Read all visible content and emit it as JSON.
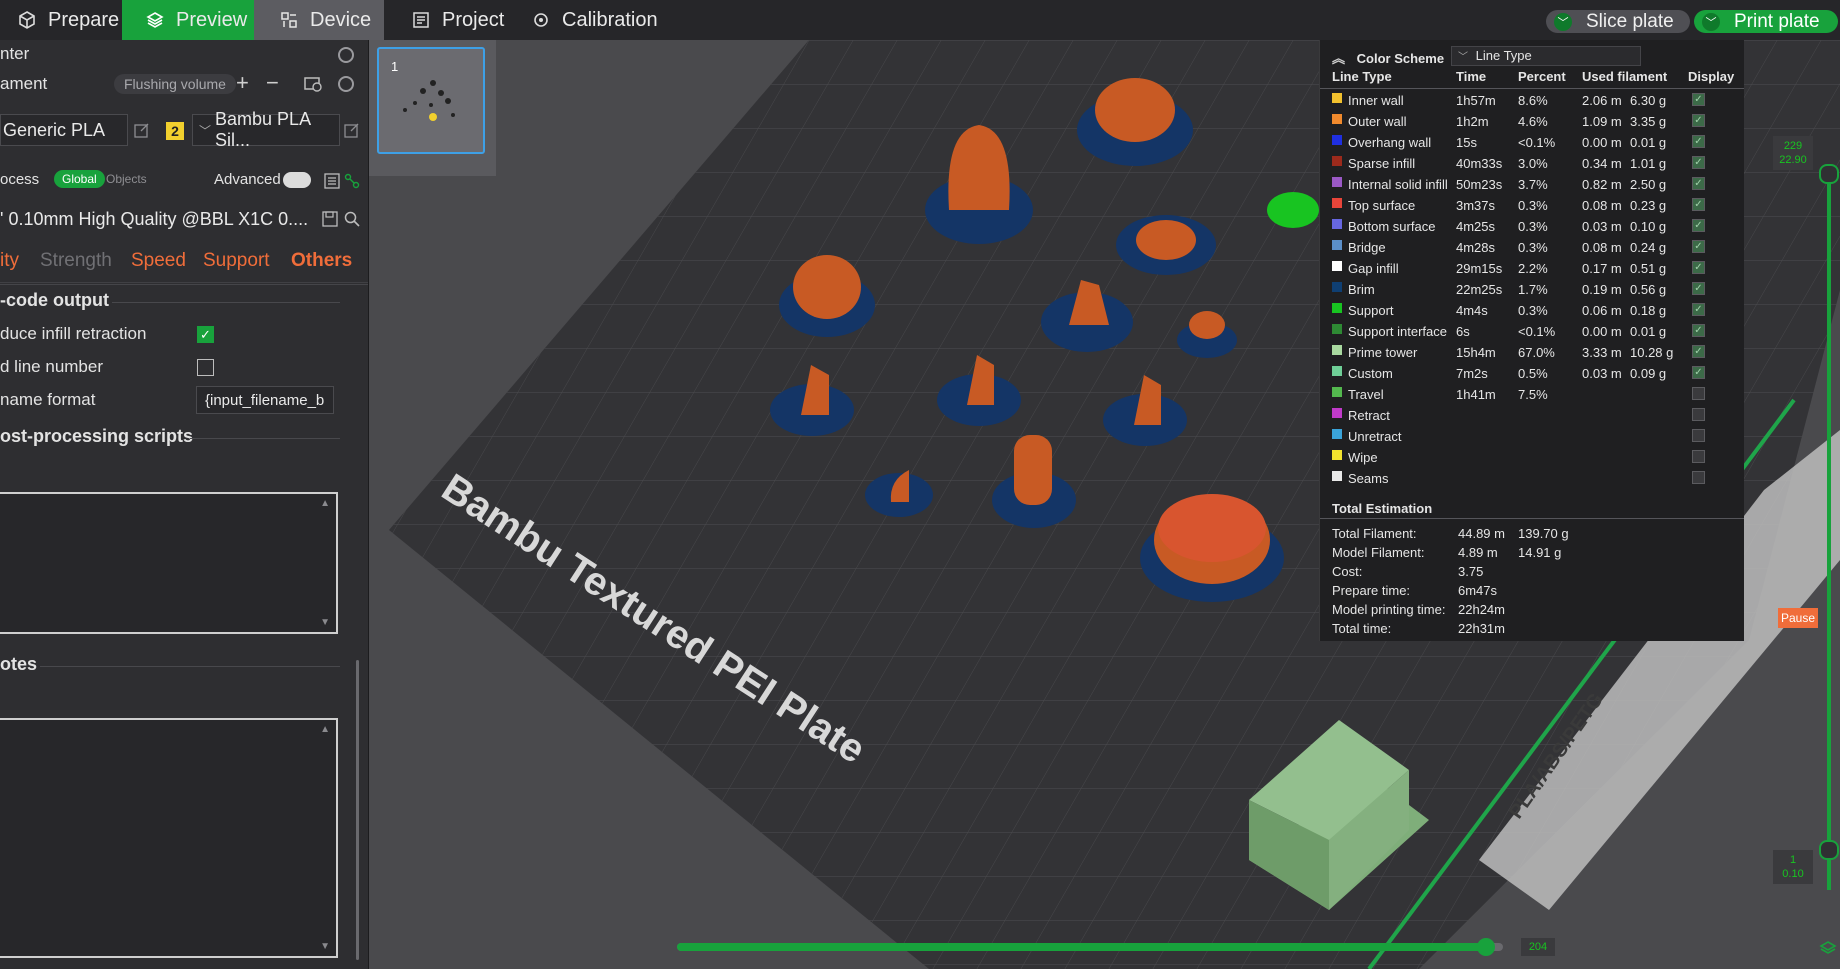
{
  "topbar": {
    "tabs": [
      {
        "label": "Prepare"
      },
      {
        "label": "Preview"
      },
      {
        "label": "Device"
      },
      {
        "label": "Project"
      },
      {
        "label": "Calibration"
      }
    ],
    "slice_label": "Slice plate",
    "print_label": "Print plate"
  },
  "sidebar": {
    "printer_label": "nter",
    "filament_label": "ament",
    "flushing_label": "Flushing volume",
    "plus": "+",
    "minus": "−",
    "filament1": "Generic PLA",
    "filament2_index": "2",
    "filament2": "Bambu PLA Sil...",
    "process_label": "ocess",
    "global_label": "Global",
    "objects_label": "Objects",
    "advanced_label": "Advanced",
    "profile": "' 0.10mm High Quality @BBL X1C 0....",
    "tabs": [
      "ity",
      "Strength",
      "Speed",
      "Support",
      "Others"
    ],
    "section_gcode": "-code output",
    "opt_reduce": "duce infill retraction",
    "opt_line": "d line number",
    "opt_filename": "name format",
    "filename_value": "{input_filename_b",
    "section_post": "ost-processing scripts",
    "section_notes": "otes"
  },
  "plate": {
    "thumb_number": "1",
    "bed_label": "Bambu Textured PEI Plate",
    "material_label": "PLA/ABS/PETG"
  },
  "legend": {
    "header": "Color Scheme",
    "scheme_value": "Line Type",
    "columns": [
      "Line Type",
      "Time",
      "Percent",
      "Used filament",
      "Display"
    ],
    "rows": [
      {
        "name": "Inner wall",
        "time": "1h57m",
        "percent": "8.6%",
        "len": "2.06 m",
        "weight": "6.30 g",
        "color": "#f2c12e",
        "display": true
      },
      {
        "name": "Outer wall",
        "time": "1h2m",
        "percent": "4.6%",
        "len": "1.09 m",
        "weight": "3.35 g",
        "color": "#f08a2d",
        "display": true
      },
      {
        "name": "Overhang wall",
        "time": "15s",
        "percent": "<0.1%",
        "len": "0.00 m",
        "weight": "0.01 g",
        "color": "#1f2fe0",
        "display": true
      },
      {
        "name": "Sparse infill",
        "time": "40m33s",
        "percent": "3.0%",
        "len": "0.34 m",
        "weight": "1.01 g",
        "color": "#9c2a1c",
        "display": true
      },
      {
        "name": "Internal solid infill",
        "time": "50m23s",
        "percent": "3.7%",
        "len": "0.82 m",
        "weight": "2.50 g",
        "color": "#9b59c6",
        "display": true
      },
      {
        "name": "Top surface",
        "time": "3m37s",
        "percent": "0.3%",
        "len": "0.08 m",
        "weight": "0.23 g",
        "color": "#e8453a",
        "display": true
      },
      {
        "name": "Bottom surface",
        "time": "4m25s",
        "percent": "0.3%",
        "len": "0.03 m",
        "weight": "0.10 g",
        "color": "#6666e0",
        "display": true
      },
      {
        "name": "Bridge",
        "time": "4m28s",
        "percent": "0.3%",
        "len": "0.08 m",
        "weight": "0.24 g",
        "color": "#5b8fc9",
        "display": true
      },
      {
        "name": "Gap infill",
        "time": "29m15s",
        "percent": "2.2%",
        "len": "0.17 m",
        "weight": "0.51 g",
        "color": "#ffffff",
        "display": true
      },
      {
        "name": "Brim",
        "time": "22m25s",
        "percent": "1.7%",
        "len": "0.19 m",
        "weight": "0.56 g",
        "color": "#0f3f73",
        "display": true
      },
      {
        "name": "Support",
        "time": "4m4s",
        "percent": "0.3%",
        "len": "0.06 m",
        "weight": "0.18 g",
        "color": "#18c421",
        "display": true
      },
      {
        "name": "Support interface",
        "time": "6s",
        "percent": "<0.1%",
        "len": "0.00 m",
        "weight": "0.01 g",
        "color": "#2e8a34",
        "display": true
      },
      {
        "name": "Prime tower",
        "time": "15h4m",
        "percent": "67.0%",
        "len": "3.33 m",
        "weight": "10.28 g",
        "color": "#a9d9a0",
        "display": true
      },
      {
        "name": "Custom",
        "time": "7m2s",
        "percent": "0.5%",
        "len": "0.03 m",
        "weight": "0.09 g",
        "color": "#6fcf97",
        "display": true
      },
      {
        "name": "Travel",
        "time": "1h41m",
        "percent": "7.5%",
        "len": "",
        "weight": "",
        "color": "#53b84e",
        "display": false
      },
      {
        "name": "Retract",
        "time": "",
        "percent": "",
        "len": "",
        "weight": "",
        "color": "#c03ac9",
        "display": false
      },
      {
        "name": "Unretract",
        "time": "",
        "percent": "",
        "len": "",
        "weight": "",
        "color": "#3aa3d9",
        "display": false
      },
      {
        "name": "Wipe",
        "time": "",
        "percent": "",
        "len": "",
        "weight": "",
        "color": "#f2e22e",
        "display": false
      },
      {
        "name": "Seams",
        "time": "",
        "percent": "",
        "len": "",
        "weight": "",
        "color": "#e9e9e9",
        "display": false
      }
    ],
    "estimation_title": "Total Estimation",
    "estimation": [
      {
        "label": "Total Filament:",
        "a": "44.89 m",
        "b": "139.70 g"
      },
      {
        "label": "Model Filament:",
        "a": "4.89 m",
        "b": "14.91 g"
      },
      {
        "label": "Cost:",
        "a": "3.75",
        "b": ""
      },
      {
        "label": "Prepare time:",
        "a": "6m47s",
        "b": ""
      },
      {
        "label": "Model printing time:",
        "a": "22h24m",
        "b": ""
      },
      {
        "label": "Total time:",
        "a": "22h31m",
        "b": ""
      }
    ]
  },
  "layer_slider": {
    "top_value": "229",
    "top_height": "22.90",
    "bottom_value": "1",
    "bottom_height": "0.10",
    "pause_label": "Pause",
    "horizontal_value": "204",
    "horizontal_fraction": 0.98
  },
  "colors": {
    "accent": "#18a23c",
    "orange": "#f06d3a"
  }
}
